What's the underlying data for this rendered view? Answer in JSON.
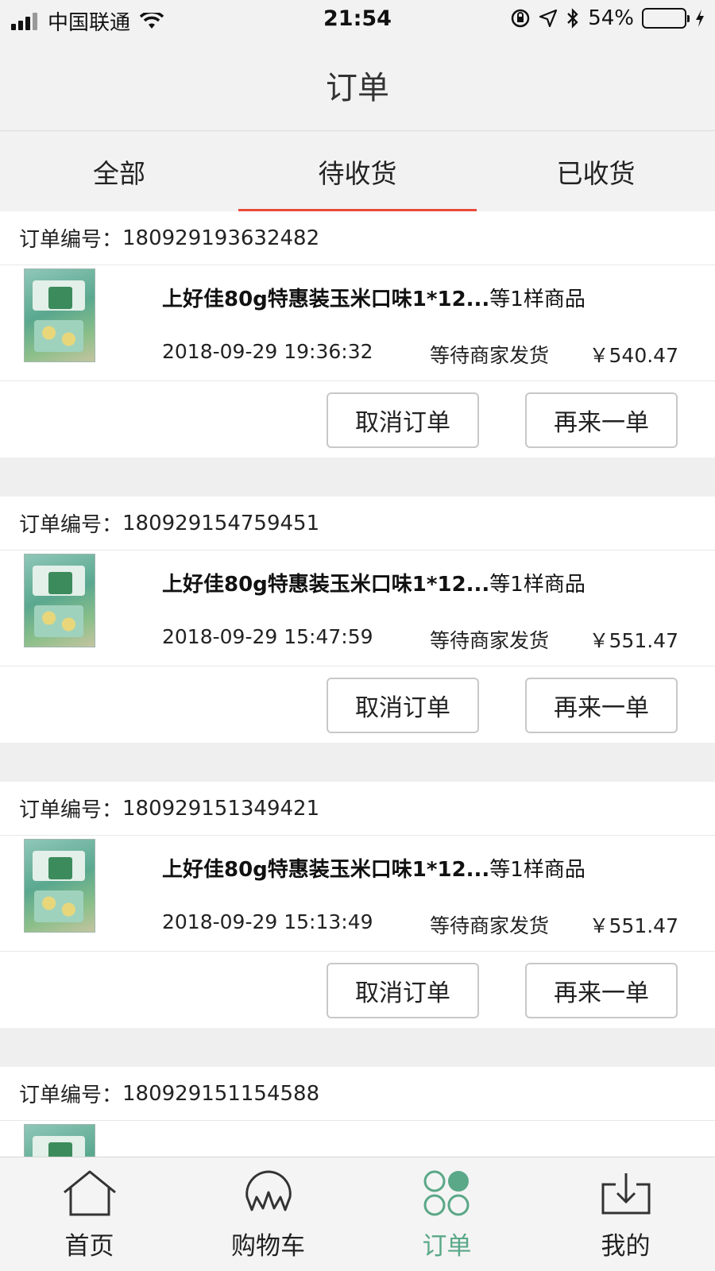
{
  "status_bar": {
    "carrier": "中国联通",
    "time": "21:54",
    "battery": "54%",
    "battery_level": 0.54
  },
  "nav": {
    "title": "订单"
  },
  "tabs": [
    {
      "label": "全部",
      "active": false
    },
    {
      "label": "待收货",
      "active": true
    },
    {
      "label": "已收货",
      "active": false
    }
  ],
  "orders": [
    {
      "order_no_label": "订单编号：",
      "order_no": "180929193632482",
      "product_name": "上好佳80g特惠装玉米口味1*12...",
      "item_count": "等1样商品",
      "time": "2018-09-29 19:36:32",
      "status": "等待商家发货",
      "price": "￥540.47",
      "cancel_label": "取消订单",
      "reorder_label": "再来一单"
    },
    {
      "order_no_label": "订单编号：",
      "order_no": "180929154759451",
      "product_name": "上好佳80g特惠装玉米口味1*12...",
      "item_count": "等1样商品",
      "time": "2018-09-29 15:47:59",
      "status": "等待商家发货",
      "price": "￥551.47",
      "cancel_label": "取消订单",
      "reorder_label": "再来一单"
    },
    {
      "order_no_label": "订单编号：",
      "order_no": "180929151349421",
      "product_name": "上好佳80g特惠装玉米口味1*12...",
      "item_count": "等1样商品",
      "time": "2018-09-29 15:13:49",
      "status": "等待商家发货",
      "price": "￥551.47",
      "cancel_label": "取消订单",
      "reorder_label": "再来一单"
    },
    {
      "order_no_label": "订单编号：",
      "order_no": "180929151154588"
    }
  ],
  "tabbar": [
    {
      "label": "首页",
      "icon": "home-icon",
      "active": false
    },
    {
      "label": "购物车",
      "icon": "cart-icon",
      "active": false
    },
    {
      "label": "订单",
      "icon": "orders-icon",
      "active": true
    },
    {
      "label": "我的",
      "icon": "download-icon",
      "active": false
    }
  ],
  "colors": {
    "accent": "#e84a3c",
    "active_tab": "#5aa887"
  }
}
